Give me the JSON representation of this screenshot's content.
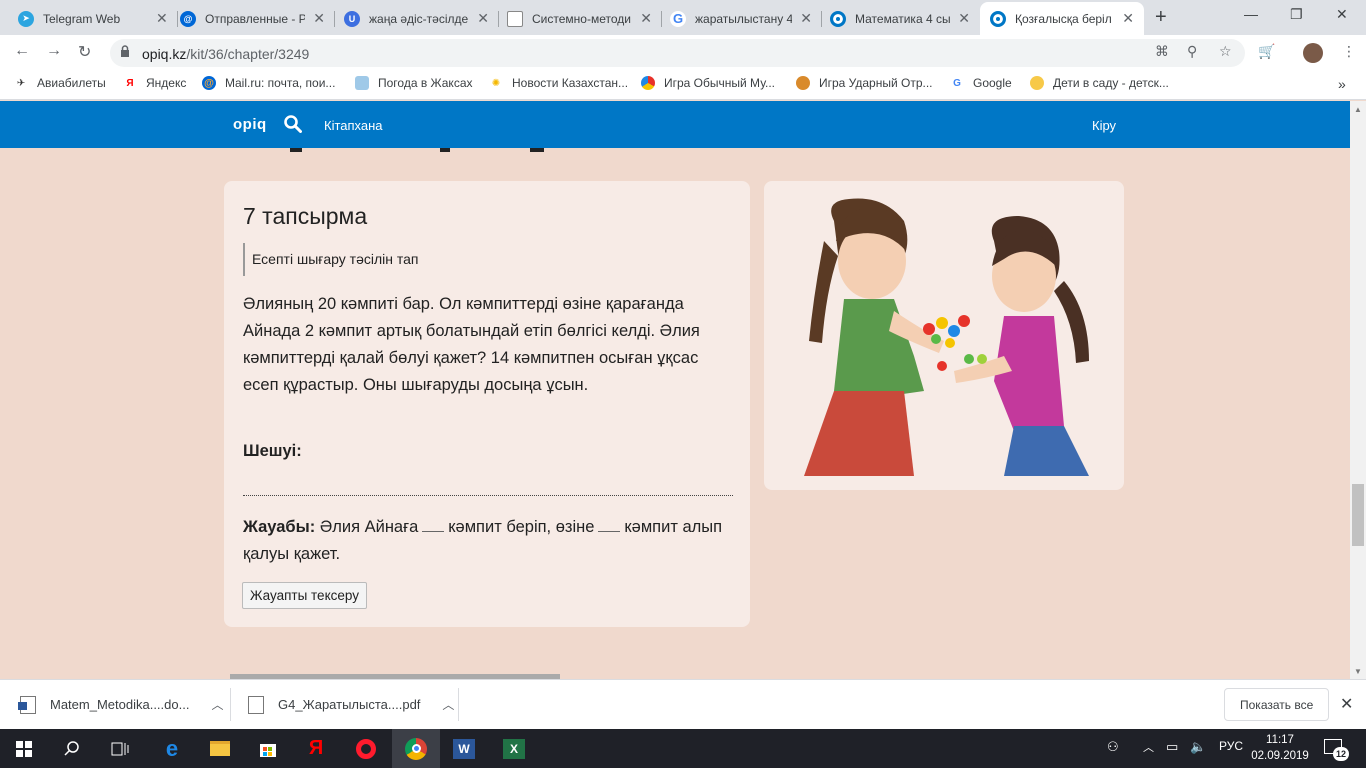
{
  "tabs": [
    {
      "title": "Telegram Web",
      "icon": "telegram-icon",
      "color": "#2ca5e0"
    },
    {
      "title": "Отправленные - P",
      "icon": "mail-icon",
      "color": "#0067d6"
    },
    {
      "title": "жаңа әдіс-тәсілде",
      "icon": "u-icon",
      "color": "#3d6fe0"
    },
    {
      "title": "Системно-методи",
      "icon": "document-icon",
      "color": "#5f6368"
    },
    {
      "title": "жаратылыстану 4",
      "icon": "google-icon",
      "color": "#4285f4"
    },
    {
      "title": "Математика 4 сы",
      "icon": "opiq-icon",
      "color": "#0077c6"
    },
    {
      "title": "Қозғалысқа беріл",
      "icon": "opiq-icon",
      "color": "#0077c6"
    }
  ],
  "address": {
    "domain": "opiq.kz",
    "path": "/kit/36/chapter/3249"
  },
  "bookmarks": [
    {
      "label": "Авиабилеты",
      "icon": "plane-icon"
    },
    {
      "label": "Яндекс",
      "icon": "yandex-icon"
    },
    {
      "label": "Mail.ru: почта, пои...",
      "icon": "mailru-icon"
    },
    {
      "label": "Погода в Жаксах",
      "icon": "weather-icon"
    },
    {
      "label": "Новости Казахстан...",
      "icon": "sun-icon"
    },
    {
      "label": "Игра Обычный Му...",
      "icon": "game-icon"
    },
    {
      "label": "Игра Ударный Отр...",
      "icon": "game2-icon"
    },
    {
      "label": "Google",
      "icon": "google-icon"
    },
    {
      "label": "Дети в саду - детск...",
      "icon": "kids-icon"
    }
  ],
  "site": {
    "logo": "opiq",
    "library": "Кітапхана",
    "login": "Кіру"
  },
  "task": {
    "title": "7 тапсырма",
    "hint": "Есепті шығару тәсілін тап",
    "problem": "Әлияның 20 кәмпиті бар. Ол кәмпиттерді өзіне қарағанда Айнада 2 кәмпит артық болатындай етіп бөлгісі келді. Әлия кәмпиттерді қалай бөлуі қажет? 14 кәмпитпен осыған ұқсас есеп құрастыр. Оны шығаруды досыңа ұсын.",
    "solution_label": "Шешуі:",
    "answer_label": "Жауабы:",
    "answer_part1": "Әлия Айнаға",
    "answer_part2": "кәмпит беріп, өзіне",
    "answer_part3": "кәмпит алып қалуы қажет.",
    "check_button": "Жауапты тексеру"
  },
  "downloads": {
    "items": [
      {
        "name": "Matem_Metodika....do...",
        "icon": "word-file-icon"
      },
      {
        "name": "G4_Жаратылыста....pdf",
        "icon": "pdf-file-icon"
      }
    ],
    "show_all": "Показать все"
  },
  "tray": {
    "lang": "РУС",
    "time": "11:17",
    "date": "02.09.2019",
    "notifications": "12"
  }
}
